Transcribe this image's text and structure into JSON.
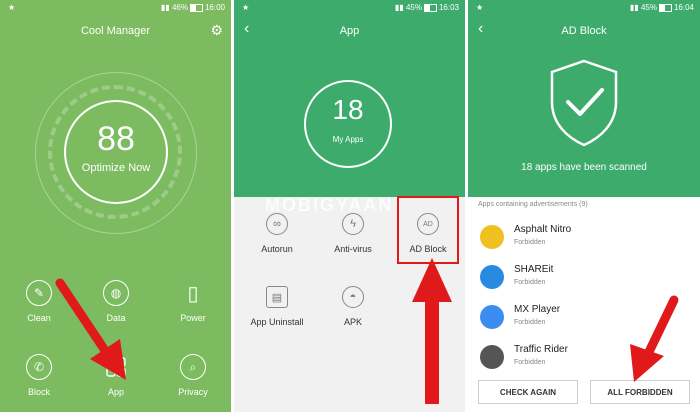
{
  "panel1": {
    "status": {
      "left": "★",
      "battery": "46%",
      "time": "16:00"
    },
    "title": "Cool Manager",
    "score": "88",
    "optimize_label": "Optimize Now",
    "grid": [
      {
        "label": "Clean",
        "icon": "broom-icon"
      },
      {
        "label": "Data",
        "icon": "data-drop-icon"
      },
      {
        "label": "Power",
        "icon": "battery-icon"
      },
      {
        "label": "Block",
        "icon": "phone-block-icon"
      },
      {
        "label": "App",
        "icon": "app-grid-icon"
      },
      {
        "label": "Privacy",
        "icon": "privacy-search-icon"
      }
    ]
  },
  "panel2": {
    "status": {
      "left": "★",
      "battery": "45%",
      "time": "16:03"
    },
    "title": "App",
    "apps_count": "18",
    "apps_label": "My Apps",
    "items": [
      {
        "label": "Autorun",
        "icon": "infinity-icon"
      },
      {
        "label": "Anti-virus",
        "icon": "shield-bolt-icon"
      },
      {
        "label": "AD Block",
        "icon": "ad-icon"
      },
      {
        "label": "App Uninstall",
        "icon": "trash-icon"
      },
      {
        "label": "APK",
        "icon": "android-icon"
      }
    ],
    "watermark": "MOBIGYAAN"
  },
  "panel3": {
    "status": {
      "left": "★",
      "battery": "45%",
      "time": "16:04"
    },
    "title": "AD Block",
    "scan_text": "18 apps have been scanned",
    "section_label": "Apps containing advertisements (9)",
    "apps": [
      {
        "name": "Asphalt Nitro",
        "status": "Forbidden",
        "color": "#f0c020"
      },
      {
        "name": "SHAREit",
        "status": "Forbidden",
        "color": "#2a8ae0"
      },
      {
        "name": "MX Player",
        "status": "Forbidden",
        "color": "#3a8cf0"
      },
      {
        "name": "Traffic Rider",
        "status": "Forbidden",
        "color": "#555555"
      }
    ],
    "check_again": "CHECK AGAIN",
    "all_forbidden": "ALL FORBIDDEN"
  },
  "colors": {
    "panel1_bg": "#7dbb60",
    "accent_green": "#3cab6c",
    "arrow_red": "#e01a1a"
  }
}
